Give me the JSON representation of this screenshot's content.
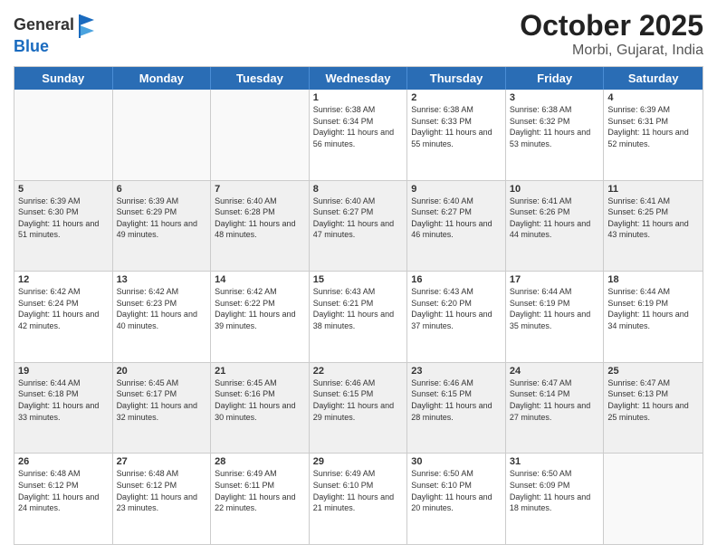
{
  "header": {
    "logo_general": "General",
    "logo_blue": "Blue",
    "title_month": "October 2025",
    "title_location": "Morbi, Gujarat, India"
  },
  "weekdays": [
    "Sunday",
    "Monday",
    "Tuesday",
    "Wednesday",
    "Thursday",
    "Friday",
    "Saturday"
  ],
  "rows": [
    [
      {
        "day": "",
        "info": ""
      },
      {
        "day": "",
        "info": ""
      },
      {
        "day": "",
        "info": ""
      },
      {
        "day": "1",
        "info": "Sunrise: 6:38 AM\nSunset: 6:34 PM\nDaylight: 11 hours and 56 minutes."
      },
      {
        "day": "2",
        "info": "Sunrise: 6:38 AM\nSunset: 6:33 PM\nDaylight: 11 hours and 55 minutes."
      },
      {
        "day": "3",
        "info": "Sunrise: 6:38 AM\nSunset: 6:32 PM\nDaylight: 11 hours and 53 minutes."
      },
      {
        "day": "4",
        "info": "Sunrise: 6:39 AM\nSunset: 6:31 PM\nDaylight: 11 hours and 52 minutes."
      }
    ],
    [
      {
        "day": "5",
        "info": "Sunrise: 6:39 AM\nSunset: 6:30 PM\nDaylight: 11 hours and 51 minutes."
      },
      {
        "day": "6",
        "info": "Sunrise: 6:39 AM\nSunset: 6:29 PM\nDaylight: 11 hours and 49 minutes."
      },
      {
        "day": "7",
        "info": "Sunrise: 6:40 AM\nSunset: 6:28 PM\nDaylight: 11 hours and 48 minutes."
      },
      {
        "day": "8",
        "info": "Sunrise: 6:40 AM\nSunset: 6:27 PM\nDaylight: 11 hours and 47 minutes."
      },
      {
        "day": "9",
        "info": "Sunrise: 6:40 AM\nSunset: 6:27 PM\nDaylight: 11 hours and 46 minutes."
      },
      {
        "day": "10",
        "info": "Sunrise: 6:41 AM\nSunset: 6:26 PM\nDaylight: 11 hours and 44 minutes."
      },
      {
        "day": "11",
        "info": "Sunrise: 6:41 AM\nSunset: 6:25 PM\nDaylight: 11 hours and 43 minutes."
      }
    ],
    [
      {
        "day": "12",
        "info": "Sunrise: 6:42 AM\nSunset: 6:24 PM\nDaylight: 11 hours and 42 minutes."
      },
      {
        "day": "13",
        "info": "Sunrise: 6:42 AM\nSunset: 6:23 PM\nDaylight: 11 hours and 40 minutes."
      },
      {
        "day": "14",
        "info": "Sunrise: 6:42 AM\nSunset: 6:22 PM\nDaylight: 11 hours and 39 minutes."
      },
      {
        "day": "15",
        "info": "Sunrise: 6:43 AM\nSunset: 6:21 PM\nDaylight: 11 hours and 38 minutes."
      },
      {
        "day": "16",
        "info": "Sunrise: 6:43 AM\nSunset: 6:20 PM\nDaylight: 11 hours and 37 minutes."
      },
      {
        "day": "17",
        "info": "Sunrise: 6:44 AM\nSunset: 6:19 PM\nDaylight: 11 hours and 35 minutes."
      },
      {
        "day": "18",
        "info": "Sunrise: 6:44 AM\nSunset: 6:19 PM\nDaylight: 11 hours and 34 minutes."
      }
    ],
    [
      {
        "day": "19",
        "info": "Sunrise: 6:44 AM\nSunset: 6:18 PM\nDaylight: 11 hours and 33 minutes."
      },
      {
        "day": "20",
        "info": "Sunrise: 6:45 AM\nSunset: 6:17 PM\nDaylight: 11 hours and 32 minutes."
      },
      {
        "day": "21",
        "info": "Sunrise: 6:45 AM\nSunset: 6:16 PM\nDaylight: 11 hours and 30 minutes."
      },
      {
        "day": "22",
        "info": "Sunrise: 6:46 AM\nSunset: 6:15 PM\nDaylight: 11 hours and 29 minutes."
      },
      {
        "day": "23",
        "info": "Sunrise: 6:46 AM\nSunset: 6:15 PM\nDaylight: 11 hours and 28 minutes."
      },
      {
        "day": "24",
        "info": "Sunrise: 6:47 AM\nSunset: 6:14 PM\nDaylight: 11 hours and 27 minutes."
      },
      {
        "day": "25",
        "info": "Sunrise: 6:47 AM\nSunset: 6:13 PM\nDaylight: 11 hours and 25 minutes."
      }
    ],
    [
      {
        "day": "26",
        "info": "Sunrise: 6:48 AM\nSunset: 6:12 PM\nDaylight: 11 hours and 24 minutes."
      },
      {
        "day": "27",
        "info": "Sunrise: 6:48 AM\nSunset: 6:12 PM\nDaylight: 11 hours and 23 minutes."
      },
      {
        "day": "28",
        "info": "Sunrise: 6:49 AM\nSunset: 6:11 PM\nDaylight: 11 hours and 22 minutes."
      },
      {
        "day": "29",
        "info": "Sunrise: 6:49 AM\nSunset: 6:10 PM\nDaylight: 11 hours and 21 minutes."
      },
      {
        "day": "30",
        "info": "Sunrise: 6:50 AM\nSunset: 6:10 PM\nDaylight: 11 hours and 20 minutes."
      },
      {
        "day": "31",
        "info": "Sunrise: 6:50 AM\nSunset: 6:09 PM\nDaylight: 11 hours and 18 minutes."
      },
      {
        "day": "",
        "info": ""
      }
    ]
  ]
}
